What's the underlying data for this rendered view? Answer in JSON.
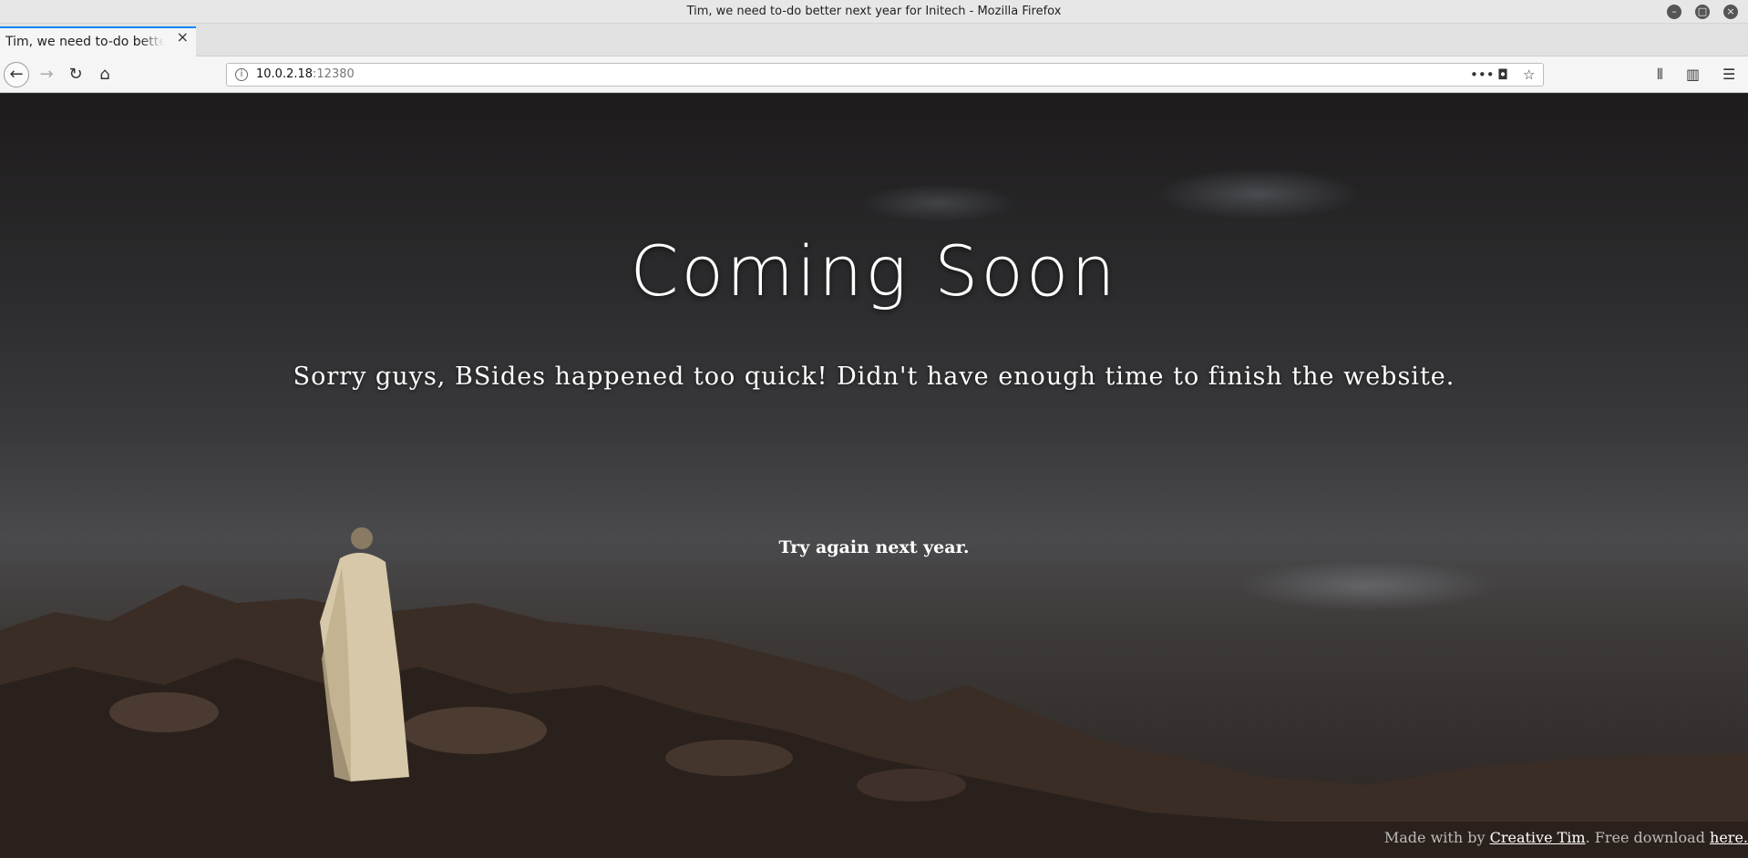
{
  "window": {
    "title": "Tim, we need to-do better next year for Initech - Mozilla Firefox"
  },
  "tabs": [
    {
      "label": "Tim, we need to-do better next year for Initech"
    }
  ],
  "navbar": {
    "url_host": "10.0.2.18",
    "url_port": ":12380"
  },
  "page": {
    "heading": "Coming Soon",
    "subtitle": "Sorry guys, BSides happened too quick! Didn't have enough time to finish the website.",
    "note": "Try again next year.",
    "footer": {
      "prefix": "Made with by ",
      "author_link": "Creative Tim",
      "middle": ". Free download ",
      "download_link": "here."
    }
  }
}
